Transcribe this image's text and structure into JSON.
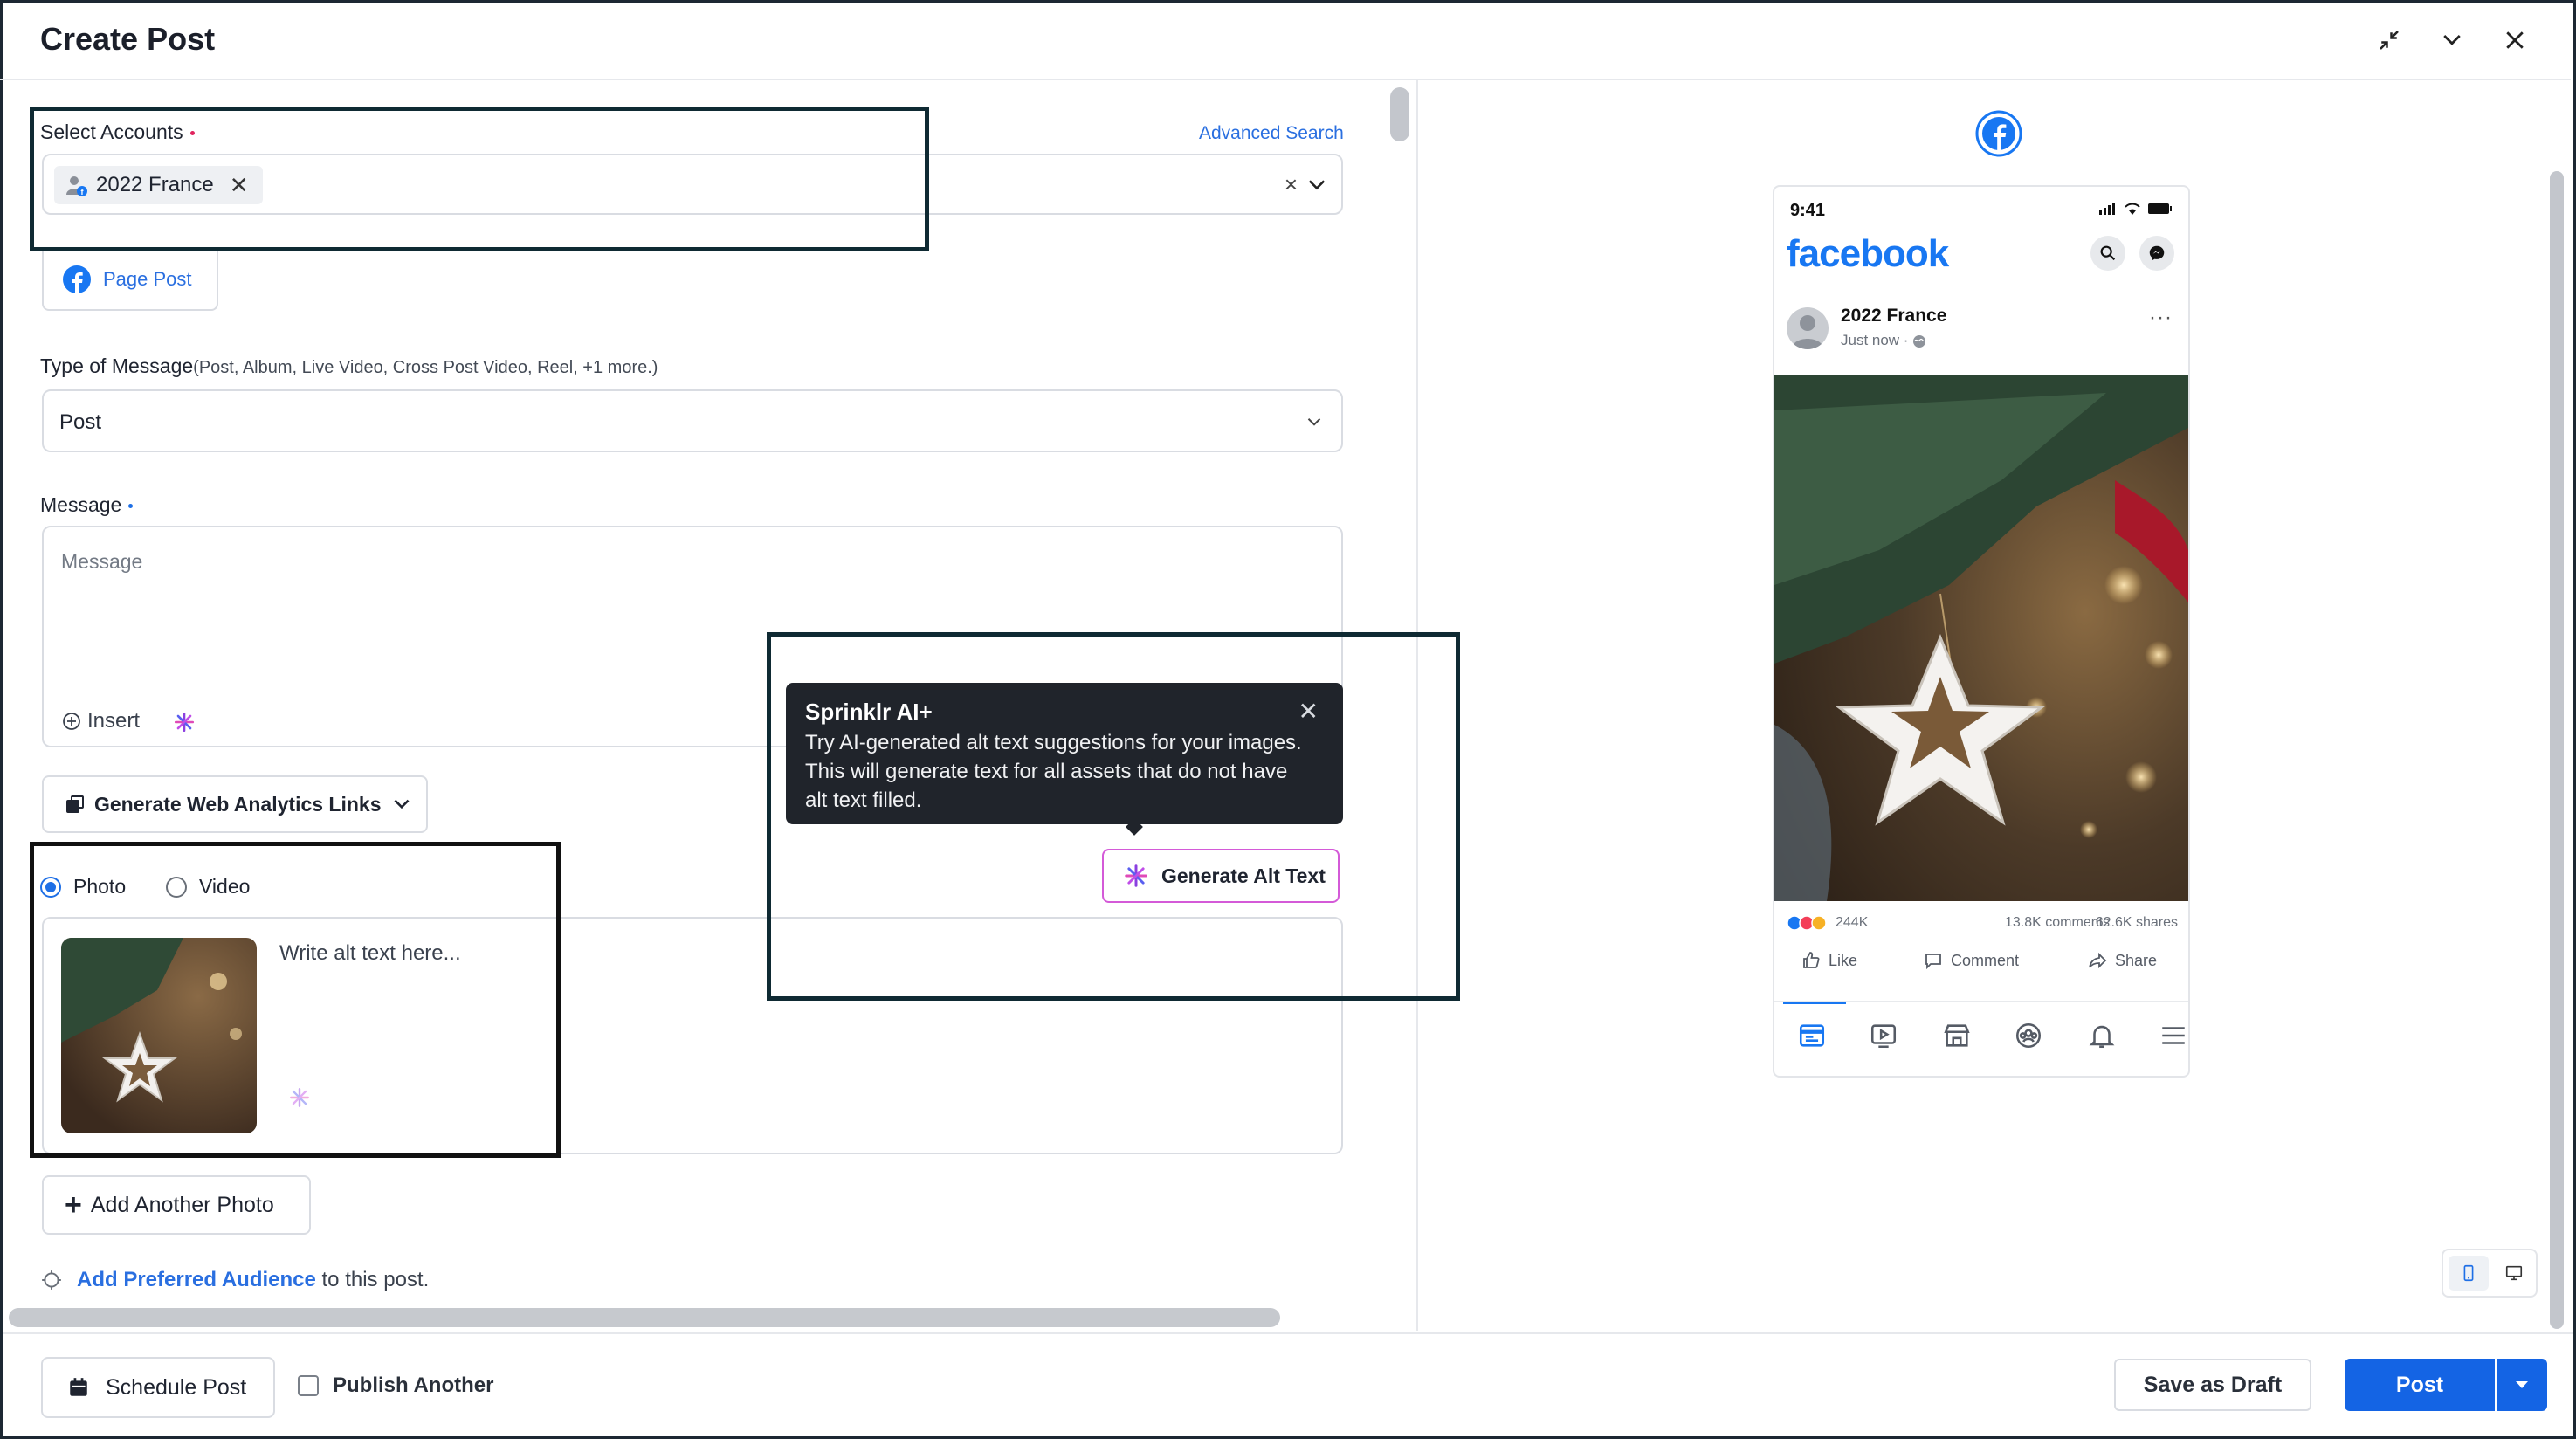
{
  "window": {
    "title": "Create Post"
  },
  "form": {
    "accounts_label": "Select Accounts",
    "advanced_search": "Advanced Search",
    "selected_account": "2022 France",
    "page_post_tab": "Page Post",
    "type_label": "Type of Message",
    "type_sub": "(Post, Album, Live Video, Cross Post Video, Reel, +1 more.)",
    "type_value": "Post",
    "message_label": "Message",
    "message_placeholder": "Message",
    "insert_label": "Insert",
    "web_analytics_label": "Generate Web Analytics Links",
    "media_photo": "Photo",
    "media_video": "Video",
    "alt_placeholder": "Write alt text here...",
    "add_photo": "Add Another Photo",
    "audience_link": "Add Preferred Audience",
    "audience_suffix": "to this post."
  },
  "tooltip": {
    "title": "Sprinklr AI+",
    "body": "Try AI-generated alt text suggestions for your images. This will generate text for all assets that do not have alt text filled.",
    "button": "Generate Alt Text"
  },
  "preview": {
    "time": "9:41",
    "brand": "facebook",
    "author": "2022 France",
    "posted": "Just now ·",
    "reactions": "244K",
    "comments": "13.8K comments",
    "shares": "62.6K shares",
    "like": "Like",
    "comment": "Comment",
    "share": "Share"
  },
  "footer": {
    "schedule": "Schedule Post",
    "publish_another": "Publish Another",
    "save_draft": "Save as Draft",
    "post": "Post"
  },
  "colors": {
    "primary": "#1464e4",
    "facebook": "#1877f2",
    "required_red": "#e0245e",
    "required_blue": "#1e6fe6",
    "ai_accent": "#d45ad8"
  }
}
